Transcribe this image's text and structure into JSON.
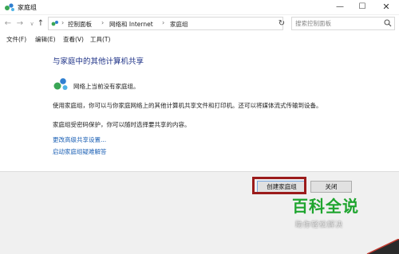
{
  "window": {
    "title": "家庭组",
    "min_glyph": "—",
    "max_glyph": "☐",
    "close_glyph": "✕"
  },
  "nav": {
    "back_glyph": "←",
    "forward_glyph": "→",
    "dropdown_glyph": "∨",
    "up_glyph": "↑",
    "refresh_glyph": "↻"
  },
  "breadcrumb": {
    "items": [
      "控制面板",
      "网络和 Internet",
      "家庭组"
    ],
    "separator": "›"
  },
  "search": {
    "placeholder": "搜索控制面板"
  },
  "menu": [
    "文件(F)",
    "编辑(E)",
    "查看(V)",
    "工具(T)"
  ],
  "content": {
    "title": "与家庭中的其他计算机共享",
    "status": "网络上当前没有家庭组。",
    "description": "使用家庭组，你可以与你家庭网络上的其他计算机共享文件和打印机。还可以将媒体流式传输到设备。",
    "password_note": "家庭组受密码保护，你可以随时选择要共享的内容。",
    "links": [
      "更改高级共享设置...",
      "启动家庭组疑难解答"
    ]
  },
  "buttons": {
    "create": "创建家庭组",
    "close": "关闭"
  },
  "watermark": {
    "main": "百科全说",
    "sub": "助你轻松解决"
  },
  "colors": {
    "title_blue": "#1e3287",
    "link_blue": "#1a5fb4",
    "highlight_red": "#9b1b1b",
    "watermark_green": "#1fa52f"
  },
  "icons": {
    "app": "homegroup-icon",
    "search": "search-icon"
  }
}
